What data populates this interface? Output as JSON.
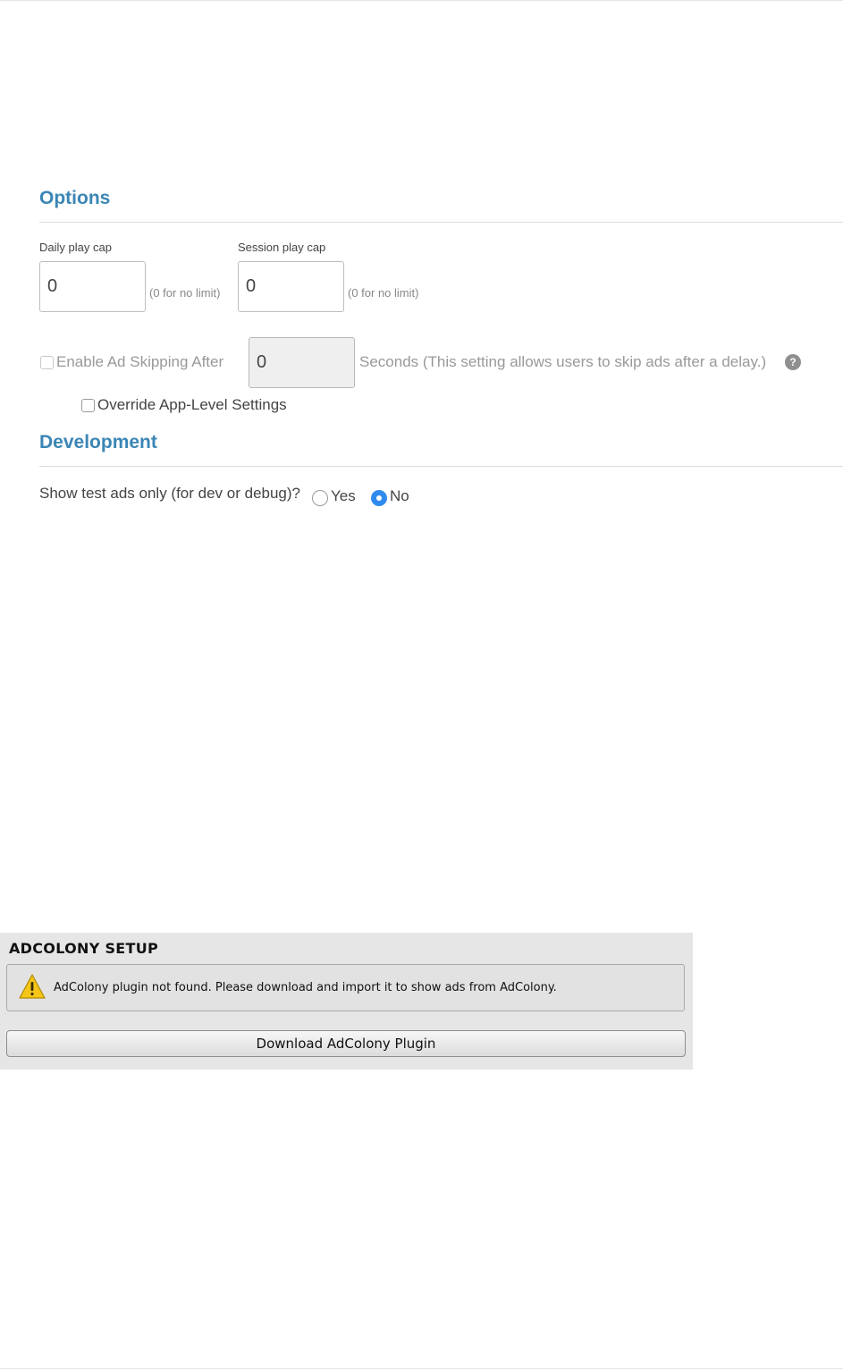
{
  "options": {
    "title": "Options",
    "daily_play_cap": {
      "label": "Daily play cap",
      "value": "0",
      "hint": "(0 for no limit)"
    },
    "session_play_cap": {
      "label": "Session play cap",
      "value": "0",
      "hint": "(0 for no limit)"
    },
    "ad_skipping": {
      "label": "Enable Ad Skipping After",
      "value": "0",
      "suffix": "Seconds (This setting allows users to skip ads after a delay.)",
      "checked": false,
      "disabled": true,
      "help_icon": "question-mark"
    },
    "override": {
      "label": "Override App-Level Settings",
      "checked": false
    }
  },
  "development": {
    "title": "Development",
    "test_ads_question": "Show test ads only (for dev or debug)?",
    "yes_label": "Yes",
    "no_label": "No",
    "selected": "No",
    "accent_color": "#2f8cee"
  },
  "adcolony_panel": {
    "title": "ADCOLONY SETUP",
    "warning_icon": "warning-triangle-icon",
    "warning_text": "AdColony plugin not found. Please download and import it to show ads from AdColony.",
    "download_button": "Download AdColony Plugin"
  },
  "colors": {
    "heading": "#3b86b5",
    "panel_bg": "#e6e6e6"
  }
}
